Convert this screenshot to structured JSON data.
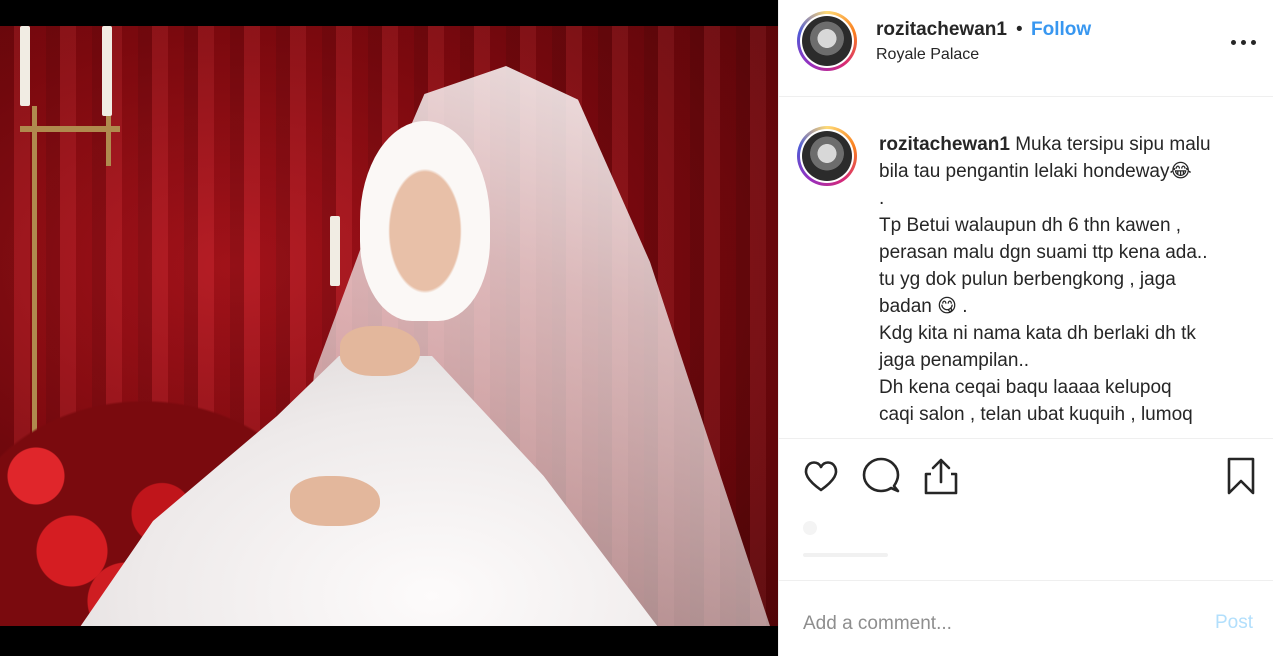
{
  "post": {
    "username": "rozitachewan1",
    "separator": "•",
    "follow_label": "Follow",
    "location": "Royale Palace"
  },
  "caption": {
    "username": "rozitachewan1",
    "lines": [
      "Muka tersipu sipu malu",
      "bila tau pengantin lelaki hondeway😂",
      ".",
      "Tp Betui walaupun dh 6 thn kawen ,",
      "perasan malu dgn suami ttp kena ada..",
      "tu yg dok pulun berbengkong , jaga",
      "badan 😋 .",
      "Kdg kita ni nama kata dh berlaki dh tk",
      "jaga penampilan..",
      "Dh kena ceqai baqu laaaa kelupoq",
      "caqi salon , telan ubat kuquih , lumoq"
    ]
  },
  "actions": {
    "like_icon": "heart-icon",
    "comment_icon": "comment-icon",
    "share_icon": "share-icon",
    "save_icon": "bookmark-icon"
  },
  "comment": {
    "placeholder": "Add a comment...",
    "post_label": "Post"
  },
  "colors": {
    "link_blue": "#3897f0",
    "post_disabled": "#b2dffc",
    "border": "#efefef"
  }
}
